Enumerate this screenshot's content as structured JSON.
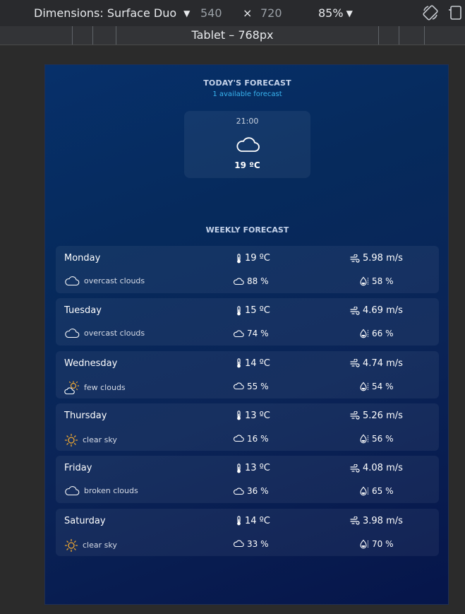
{
  "devtools": {
    "device_label": "Dimensions: Surface Duo",
    "width": "540",
    "times": "×",
    "height": "720",
    "zoom": "85%",
    "media_query_label": "Tablet – 768px"
  },
  "today": {
    "title": "TODAY'S FORECAST",
    "subtitle": "1 available forecast",
    "time": "21:00",
    "icon": "cloud-icon",
    "temp": "19 ºC"
  },
  "weekly": {
    "title": "WEEKLY FORECAST",
    "days": [
      {
        "name": "Monday",
        "temp": "19 ºC",
        "wind": "5.98 m/s",
        "desc": "overcast clouds",
        "icon": "cloud-icon",
        "clouds": "88 %",
        "humidity": "58 %"
      },
      {
        "name": "Tuesday",
        "temp": "15 ºC",
        "wind": "4.69 m/s",
        "desc": "overcast clouds",
        "icon": "cloud-icon",
        "clouds": "74 %",
        "humidity": "66 %"
      },
      {
        "name": "Wednesday",
        "temp": "14 ºC",
        "wind": "4.74 m/s",
        "desc": "few clouds",
        "icon": "sun-cloud-icon",
        "clouds": "55 %",
        "humidity": "54 %"
      },
      {
        "name": "Thursday",
        "temp": "13 ºC",
        "wind": "5.26 m/s",
        "desc": "clear sky",
        "icon": "sun-icon",
        "clouds": "16 %",
        "humidity": "56 %"
      },
      {
        "name": "Friday",
        "temp": "13 ºC",
        "wind": "4.08 m/s",
        "desc": "broken clouds",
        "icon": "cloud-icon",
        "clouds": "36 %",
        "humidity": "65 %"
      },
      {
        "name": "Saturday",
        "temp": "14 ºC",
        "wind": "3.98 m/s",
        "desc": "clear sky",
        "icon": "sun-icon",
        "clouds": "33 %",
        "humidity": "70 %"
      }
    ]
  },
  "colors": {
    "accent": "#39b5f0",
    "sun": "#f0a830"
  }
}
